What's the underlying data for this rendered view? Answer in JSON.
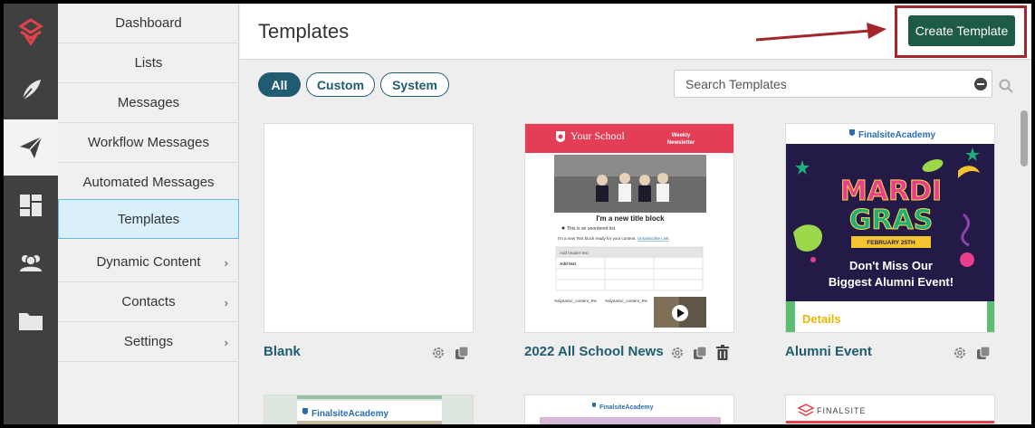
{
  "nav": {
    "items": [
      {
        "label": "Dashboard",
        "has_submenu": false
      },
      {
        "label": "Lists",
        "has_submenu": false
      },
      {
        "label": "Messages",
        "has_submenu": false
      },
      {
        "label": "Workflow Messages",
        "has_submenu": false
      },
      {
        "label": "Automated Messages",
        "has_submenu": false
      },
      {
        "label": "Templates",
        "has_submenu": false,
        "active": true
      },
      {
        "label": "Dynamic Content",
        "has_submenu": true
      },
      {
        "label": "Contacts",
        "has_submenu": true
      },
      {
        "label": "Settings",
        "has_submenu": true
      }
    ],
    "chevron": "›"
  },
  "rail": {
    "icons": [
      "logo-icon",
      "feather-icon",
      "paper-plane-icon",
      "dashboard-grid-icon",
      "people-icon",
      "folder-icon"
    ],
    "active": "paper-plane-icon"
  },
  "header": {
    "title": "Templates",
    "create_label": "Create Template"
  },
  "filters": [
    "All",
    "Custom",
    "System"
  ],
  "active_filter": "All",
  "search": {
    "placeholder": "Search Templates",
    "value": ""
  },
  "cards": [
    {
      "name": "Blank",
      "actions": [
        "settings-icon",
        "copy-icon"
      ]
    },
    {
      "name": "2022 All School News",
      "actions": [
        "settings-icon",
        "copy-icon",
        "trash-icon"
      ]
    },
    {
      "name": "Alumni Event",
      "actions": [
        "settings-icon",
        "copy-icon"
      ]
    }
  ],
  "preview_school": {
    "brand": "Your School",
    "badge": "Weekly\nNewsletter",
    "block_title": "I'm a new title block",
    "bullet": "This is an unordered list",
    "body": "I'm a new Text block ready for your content.",
    "link": "Unsubscribe Link",
    "table_header": "Add header text",
    "table_cell": "Add text",
    "token1": "%dynamic_content_9%",
    "token2": "%dynamic_content_9%"
  },
  "preview_alumni": {
    "brand": "FinalsiteAcademy",
    "line1": "MARDI",
    "line2": "GRAS",
    "date": "FEBRUARY 25TH",
    "tagline1": "Don't Miss Our",
    "tagline2": "Biggest Alumni Event!",
    "details": "Details"
  },
  "preview_row2": {
    "card1_brand": "FinalsiteAcademy",
    "card2_brand": "FinalsiteAcademy",
    "card3_brand": "FINALSITE"
  },
  "colors": {
    "accent": "#1f5c72",
    "create_button": "#1d5b45",
    "highlight": "#a3262b",
    "school_red": "#e43d56",
    "alumni_purple": "#241a48"
  }
}
